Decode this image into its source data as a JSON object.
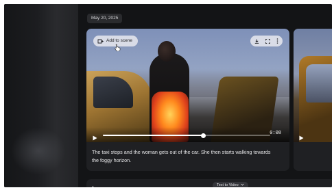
{
  "date_chip": "May 20, 2025",
  "card": {
    "add_to_scene_label": "Add to scene",
    "video": {
      "time": "0:08",
      "progress": 0.6
    },
    "caption": "The taxi stops and the woman gets out of the car. She then starts walking towards the foggy horizon."
  },
  "bottom": {
    "text_to_video_label": "Text to Video"
  },
  "icons": {
    "add_to_scene": "add-to-scene-icon",
    "download": "download-icon",
    "fullscreen": "fullscreen-icon",
    "more": "more-vert-icon",
    "play": "play-icon",
    "dropdown": "chevron-down-icon",
    "cursor": "pointer-cursor-icon"
  },
  "colors": {
    "background": "#131416",
    "card": "#1f2023",
    "pill": "#ebecf0"
  }
}
